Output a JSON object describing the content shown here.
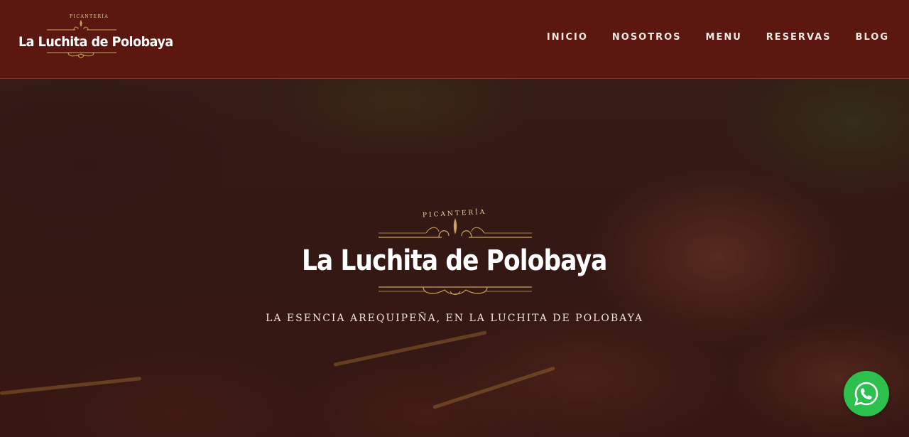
{
  "header": {
    "logo": {
      "small_text": "PICANTERÍA",
      "name": "La Luchita de Polobaya"
    },
    "nav": [
      {
        "label": "INICIO"
      },
      {
        "label": "NOSOTROS"
      },
      {
        "label": "MENU"
      },
      {
        "label": "RESERVAS"
      },
      {
        "label": "BLOG"
      }
    ]
  },
  "hero": {
    "emblem": {
      "small_text": "PICANTERÍA",
      "name": "La Luchita de Polobaya"
    },
    "tagline": "LA ESENCIA AREQUIPEÑA, EN LA LUCHITA DE POLOBAYA"
  },
  "floating": {
    "whatsapp_icon": "whatsapp-icon"
  },
  "colors": {
    "header_bg": "#5c1710",
    "gold": "#c9a45e",
    "whatsapp_green": "#2cc14f"
  }
}
